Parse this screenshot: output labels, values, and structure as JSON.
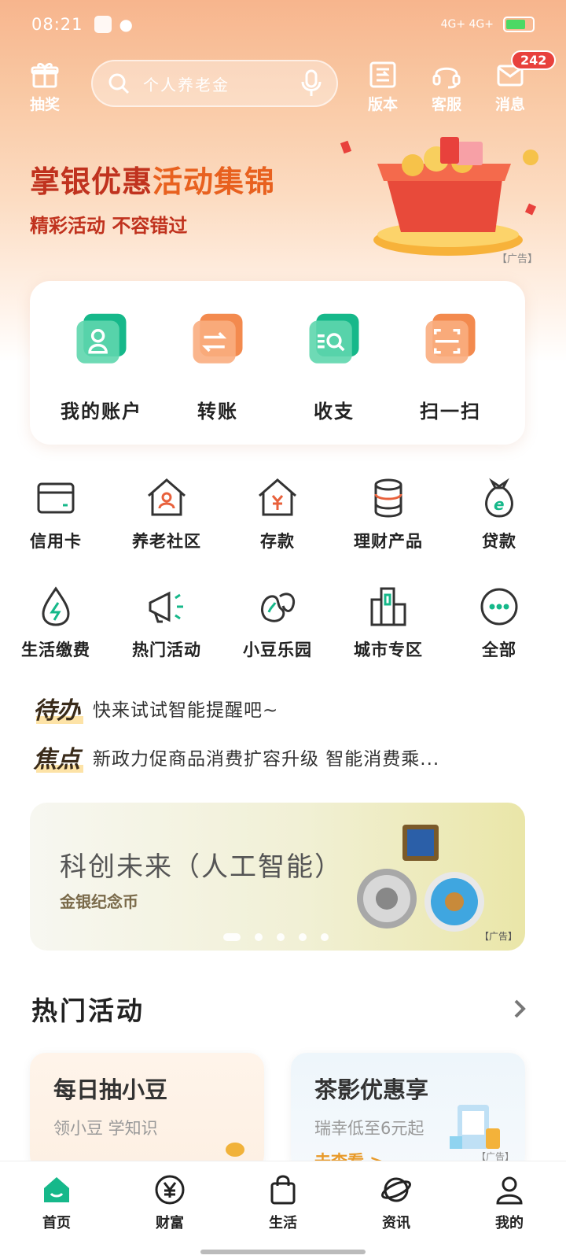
{
  "status": {
    "time": "08:21",
    "right_text": "4G+  4G+"
  },
  "header": {
    "lottery_label": "抽奖",
    "search_placeholder": "个人养老金",
    "version_label": "版本",
    "service_label": "客服",
    "message_label": "消息",
    "message_badge": "242"
  },
  "promo": {
    "title_a": "掌银优惠",
    "title_b": "活动集锦",
    "subtitle": "精彩活动 不容错过",
    "ad_tag": "【广告】"
  },
  "quick_card": [
    {
      "label": "我的账户",
      "icon": "account-icon"
    },
    {
      "label": "转账",
      "icon": "transfer-icon"
    },
    {
      "label": "收支",
      "icon": "income-expense-icon"
    },
    {
      "label": "扫一扫",
      "icon": "scan-icon"
    }
  ],
  "grid": [
    {
      "label": "信用卡",
      "icon": "credit-card-icon"
    },
    {
      "label": "养老社区",
      "icon": "elder-community-icon"
    },
    {
      "label": "存款",
      "icon": "deposit-icon"
    },
    {
      "label": "理财产品",
      "icon": "wealth-product-icon"
    },
    {
      "label": "贷款",
      "icon": "loan-icon"
    },
    {
      "label": "生活缴费",
      "icon": "utility-payment-icon"
    },
    {
      "label": "热门活动",
      "icon": "megaphone-icon"
    },
    {
      "label": "小豆乐园",
      "icon": "bean-park-icon"
    },
    {
      "label": "城市专区",
      "icon": "city-zone-icon"
    },
    {
      "label": "全部",
      "icon": "more-icon"
    }
  ],
  "notices": [
    {
      "tag": "待办",
      "text": "快来试试智能提醒吧~"
    },
    {
      "tag": "焦点",
      "text": "新政力促商品消费扩容升级 智能消费乘..."
    }
  ],
  "banner": {
    "title": "科创未来（人工智能）",
    "subtitle": "金银纪念币",
    "ad": "【广告】"
  },
  "hot_section": {
    "title": "热门活动"
  },
  "activities": [
    {
      "title": "每日抽小豆",
      "desc": "领小豆 学知识",
      "link": "",
      "ad": ""
    },
    {
      "title": "茶影优惠享",
      "desc": "瑞幸低至6元起",
      "link": "去查看 >",
      "ad": "【广告】"
    }
  ],
  "tabs": [
    {
      "label": "首页",
      "icon": "home-icon"
    },
    {
      "label": "财富",
      "icon": "yuan-icon"
    },
    {
      "label": "生活",
      "icon": "shopping-bag-icon"
    },
    {
      "label": "资讯",
      "icon": "planet-icon"
    },
    {
      "label": "我的",
      "icon": "user-icon"
    }
  ],
  "colors": {
    "accent": "#16b88a",
    "brand_red": "#c0321e",
    "badge": "#e8413c"
  }
}
